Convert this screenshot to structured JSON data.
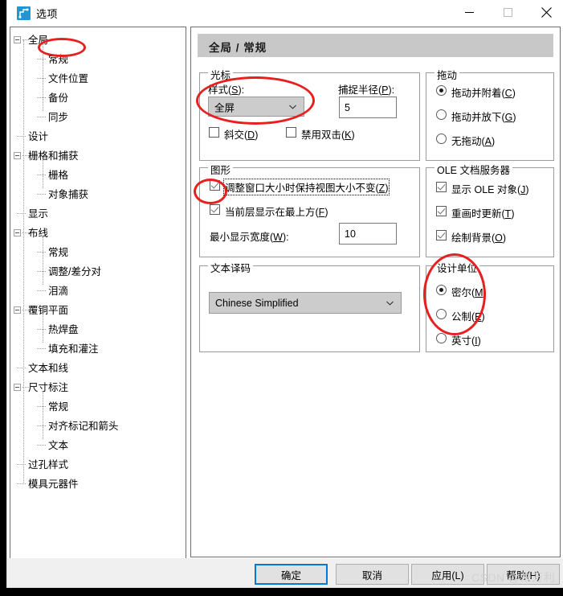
{
  "window": {
    "title": "选项",
    "icon": "route-icon",
    "minimize": "–",
    "maximize": "□",
    "close": "✕"
  },
  "tree": {
    "items": [
      {
        "label": "全局",
        "level": 0,
        "expander": true
      },
      {
        "label": "常规",
        "level": 1,
        "expander": false,
        "annotated": true
      },
      {
        "label": "文件位置",
        "level": 1,
        "expander": false
      },
      {
        "label": "备份",
        "level": 1,
        "expander": false
      },
      {
        "label": "同步",
        "level": 1,
        "expander": false
      },
      {
        "label": "设计",
        "level": 0,
        "expander": false
      },
      {
        "label": "栅格和捕获",
        "level": 0,
        "expander": true
      },
      {
        "label": "栅格",
        "level": 1,
        "expander": false
      },
      {
        "label": "对象捕获",
        "level": 1,
        "expander": false
      },
      {
        "label": "显示",
        "level": 0,
        "expander": false
      },
      {
        "label": "布线",
        "level": 0,
        "expander": true
      },
      {
        "label": "常规",
        "level": 1,
        "expander": false
      },
      {
        "label": "调整/差分对",
        "level": 1,
        "expander": false
      },
      {
        "label": "泪滴",
        "level": 1,
        "expander": false
      },
      {
        "label": "覆铜平面",
        "level": 0,
        "expander": true
      },
      {
        "label": "热焊盘",
        "level": 1,
        "expander": false
      },
      {
        "label": "填充和灌注",
        "level": 1,
        "expander": false
      },
      {
        "label": "文本和线",
        "level": 0,
        "expander": false
      },
      {
        "label": "尺寸标注",
        "level": 0,
        "expander": true
      },
      {
        "label": "常规",
        "level": 1,
        "expander": false
      },
      {
        "label": "对齐标记和箭头",
        "level": 1,
        "expander": false
      },
      {
        "label": "文本",
        "level": 1,
        "expander": false
      },
      {
        "label": "过孔样式",
        "level": 0,
        "expander": false
      },
      {
        "label": "模具元器件",
        "level": 0,
        "expander": false
      }
    ]
  },
  "page": {
    "header": "全局 / 常规",
    "cursor": {
      "title": "光标",
      "style_label": "样式(S):",
      "style_value": "全屏",
      "capture_label": "捕捉半径(P):",
      "capture_value": "5",
      "oblique_label": "斜交(D)",
      "oblique_checked": false,
      "nodouble_label": "禁用双击(K)",
      "nodouble_checked": false
    },
    "graphics": {
      "title": "图形",
      "keep_view_label": "调整窗口大小时保持视图大小不变(Z)",
      "keep_view_checked": true,
      "top_layer_label": "当前层显示在最上方(F)",
      "top_layer_checked": true,
      "min_width_label": "最小显示宽度(W):",
      "min_width_value": "10"
    },
    "textcode": {
      "title": "文本译码",
      "value": "Chinese Simplified"
    },
    "drag": {
      "title": "拖动",
      "options": [
        {
          "label": "拖动并附着(C)",
          "selected": true
        },
        {
          "label": "拖动并放下(G)",
          "selected": false
        },
        {
          "label": "无拖动(A)",
          "selected": false
        }
      ]
    },
    "ole": {
      "title": "OLE 文档服务器",
      "options": [
        {
          "label": "显示 OLE 对象(J)",
          "checked": true
        },
        {
          "label": "重画时更新(T)",
          "checked": true
        },
        {
          "label": "绘制背景(O)",
          "checked": true
        }
      ]
    },
    "units": {
      "title": "设计单位",
      "options": [
        {
          "label": "密尔(M)",
          "selected": true
        },
        {
          "label": "公制(E)",
          "selected": false
        },
        {
          "label": "英寸(I)",
          "selected": false
        }
      ]
    }
  },
  "footer": {
    "ok": "确定",
    "cancel": "取消",
    "apply": "应用(L)",
    "help": "帮助(H)"
  },
  "watermark": "CSDN @朱万利"
}
